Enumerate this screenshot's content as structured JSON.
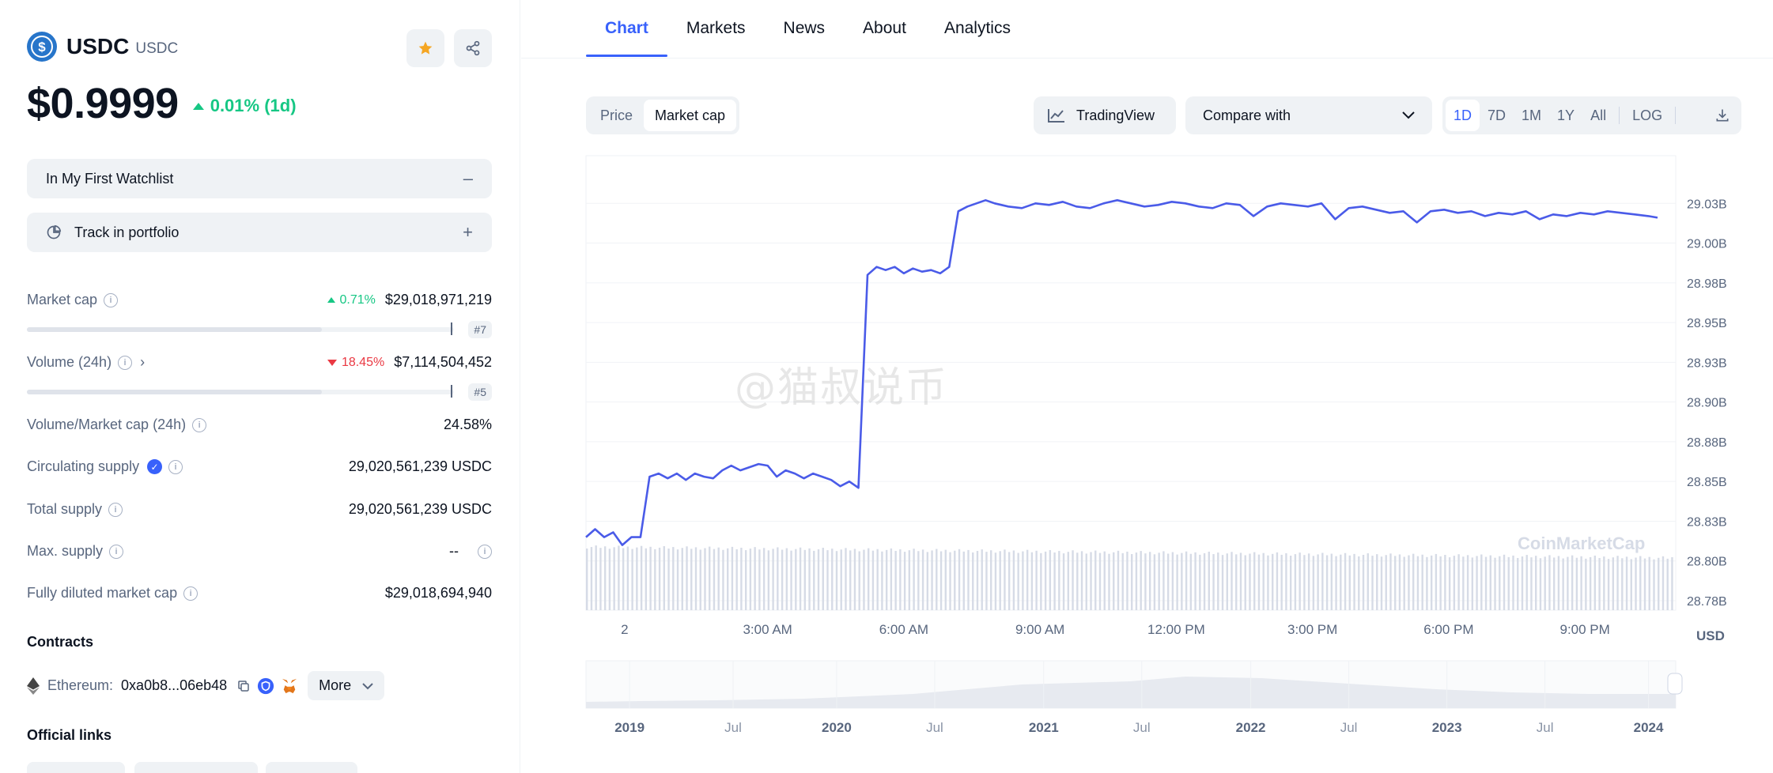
{
  "coin": {
    "name": "USDC",
    "symbol": "USDC",
    "price": "$0.9999",
    "change_1d": "0.01% (1d)"
  },
  "actions": {
    "watchlist_label": "In My First Watchlist",
    "watchlist_trailing": "–",
    "portfolio_label": "Track in portfolio",
    "portfolio_trailing": "+"
  },
  "stats": {
    "market_cap": {
      "label": "Market cap",
      "change": "0.71%",
      "value": "$29,018,971,219",
      "rank": "#7",
      "fill_fraction": 0.69
    },
    "volume": {
      "label": "Volume (24h)",
      "change": "18.45%",
      "value": "$7,114,504,452",
      "rank": "#5",
      "fill_fraction": 0.69
    },
    "vol_mcap": {
      "label": "Volume/Market cap (24h)",
      "value": "24.58%"
    },
    "circulating": {
      "label": "Circulating supply",
      "value": "29,020,561,239 USDC"
    },
    "total": {
      "label": "Total supply",
      "value": "29,020,561,239 USDC"
    },
    "max": {
      "label": "Max. supply",
      "value": "--"
    },
    "fdmc": {
      "label": "Fully diluted market cap",
      "value": "$29,018,694,940"
    }
  },
  "contracts": {
    "title": "Contracts",
    "chain": "Ethereum:",
    "address": "0xa0b8...06eb48",
    "more_label": "More"
  },
  "links": {
    "title": "Official links"
  },
  "tabs": [
    "Chart",
    "Markets",
    "News",
    "About",
    "Analytics"
  ],
  "chart_controls": {
    "seg": [
      "Price",
      "Market cap"
    ],
    "tradingview": "TradingView",
    "compare": "Compare with",
    "ranges": [
      "1D",
      "7D",
      "1M",
      "1Y",
      "All"
    ],
    "log": "LOG"
  },
  "colors": {
    "accent": "#3861fb",
    "up": "#16c784",
    "down": "#ea3943",
    "line": "#4a5be8"
  },
  "watermark_text": "@猫叔说币",
  "chart_data": {
    "type": "line",
    "title": "",
    "xlabel": "",
    "ylabel": "",
    "unit_label": "USD",
    "x_ticks": [
      "2",
      "3:00 AM",
      "6:00 AM",
      "9:00 AM",
      "12:00 PM",
      "3:00 PM",
      "6:00 PM",
      "9:00 PM"
    ],
    "y_ticks": [
      "29.03B",
      "29.00B",
      "28.98B",
      "28.95B",
      "28.93B",
      "28.90B",
      "28.88B",
      "28.85B",
      "28.83B",
      "28.80B",
      "28.78B"
    ],
    "ylim": [
      28.78,
      29.055
    ],
    "x_hours": [
      0,
      0.2,
      0.4,
      0.6,
      0.8,
      1.0,
      1.2,
      1.4,
      1.6,
      1.8,
      2.0,
      2.2,
      2.4,
      2.6,
      2.8,
      3.0,
      3.2,
      3.4,
      3.6,
      3.8,
      4.0,
      4.2,
      4.4,
      4.6,
      4.8,
      5.0,
      5.2,
      5.4,
      5.6,
      5.8,
      6.0,
      6.2,
      6.4,
      6.6,
      6.8,
      7.0,
      7.2,
      7.4,
      7.6,
      7.8,
      8.0,
      8.2,
      8.4,
      8.6,
      8.8,
      9.0,
      9.3,
      9.6,
      9.9,
      10.2,
      10.5,
      10.8,
      11.1,
      11.4,
      11.7,
      12.0,
      12.3,
      12.6,
      12.9,
      13.2,
      13.5,
      13.8,
      14.1,
      14.4,
      14.7,
      15.0,
      15.3,
      15.6,
      15.9,
      16.2,
      16.5,
      16.8,
      17.1,
      17.4,
      17.7,
      18.0,
      18.3,
      18.6,
      18.9,
      19.2,
      19.5,
      19.8,
      20.1,
      20.4,
      20.7,
      21.0,
      21.3,
      21.6,
      21.9,
      22.2,
      22.5,
      22.8,
      23.1,
      23.4,
      23.6
    ],
    "values": [
      28.82,
      28.825,
      28.82,
      28.823,
      28.815,
      28.82,
      28.82,
      28.858,
      28.86,
      28.857,
      28.86,
      28.856,
      28.86,
      28.858,
      28.857,
      28.862,
      28.865,
      28.862,
      28.864,
      28.866,
      28.865,
      28.858,
      28.862,
      28.86,
      28.857,
      28.86,
      28.858,
      28.856,
      28.852,
      28.855,
      28.851,
      28.985,
      28.99,
      28.988,
      28.99,
      28.986,
      28.989,
      28.987,
      28.988,
      28.986,
      28.99,
      29.025,
      29.028,
      29.03,
      29.032,
      29.03,
      29.028,
      29.027,
      29.03,
      29.029,
      29.031,
      29.028,
      29.027,
      29.03,
      29.032,
      29.03,
      29.028,
      29.029,
      29.031,
      29.03,
      29.028,
      29.027,
      29.03,
      29.029,
      29.022,
      29.028,
      29.03,
      29.029,
      29.028,
      29.03,
      29.02,
      29.027,
      29.028,
      29.026,
      29.024,
      29.025,
      29.018,
      29.025,
      29.026,
      29.024,
      29.025,
      29.022,
      29.024,
      29.023,
      29.025,
      29.02,
      29.023,
      29.022,
      29.024,
      29.023,
      29.025,
      29.024,
      29.023,
      29.022,
      29.021
    ],
    "nav_ticks": [
      "2019",
      "Jul",
      "2020",
      "Jul",
      "2021",
      "Jul",
      "2022",
      "Jul",
      "2023",
      "Jul",
      "2024"
    ],
    "watermark": "CoinMarketCap",
    "grid": true,
    "legend": "none"
  }
}
